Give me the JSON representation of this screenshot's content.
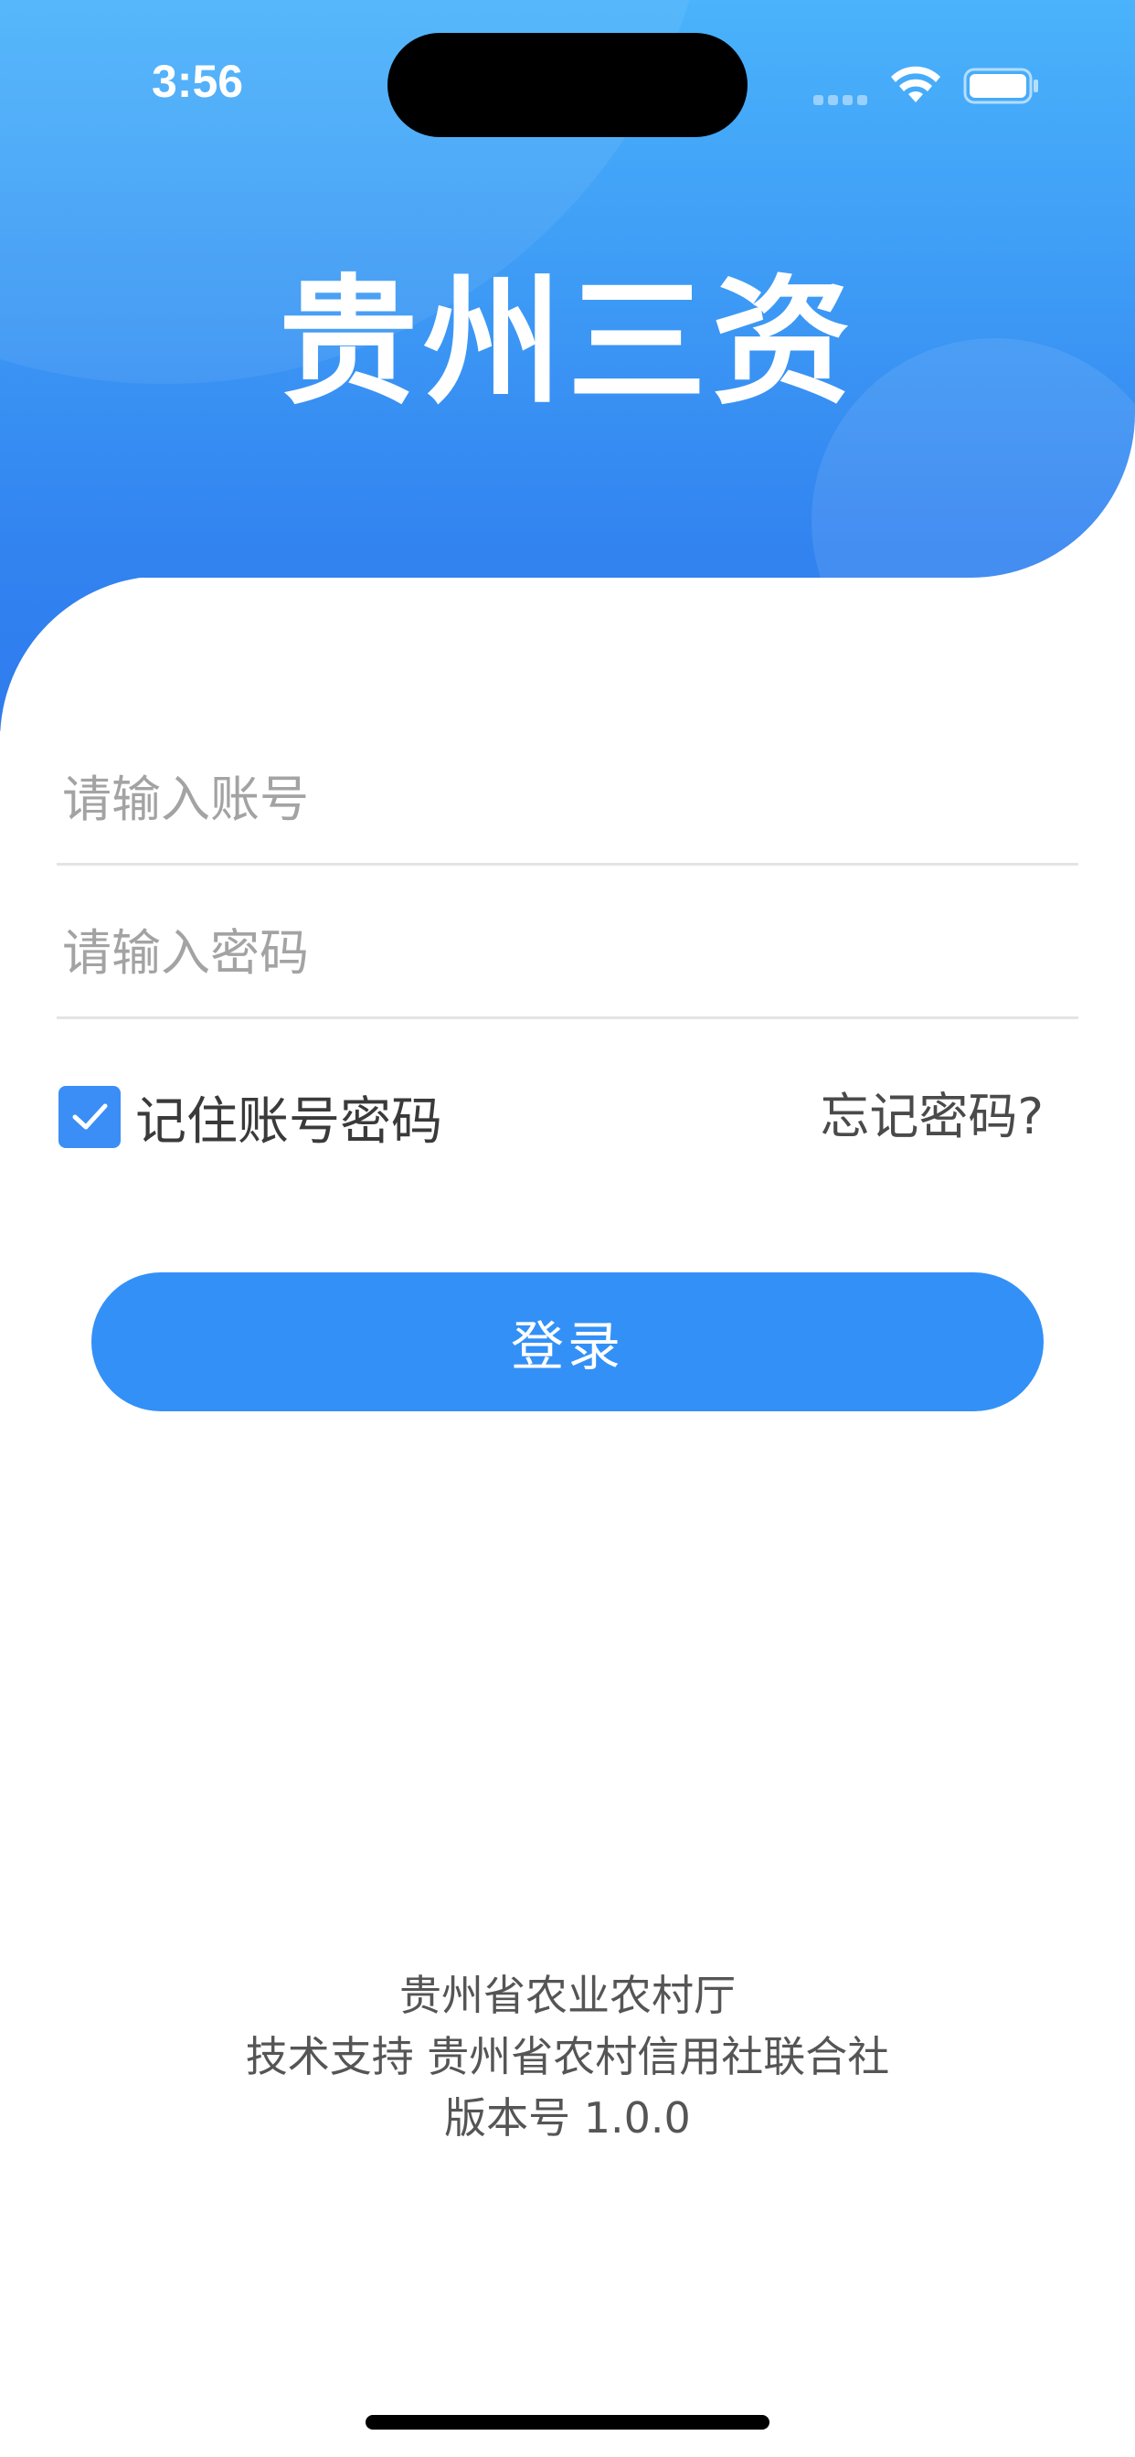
{
  "status_bar": {
    "time": "3:56"
  },
  "app": {
    "title": "贵州三资"
  },
  "form": {
    "account_placeholder": "请输入账号",
    "password_placeholder": "请输入密码",
    "remember_label": "记住账号密码",
    "remember_checked": true,
    "forgot_label": "忘记密码?",
    "login_label": "登录"
  },
  "footer": {
    "line1": "贵州省农业农村厅",
    "line2": "技术支持 贵州省农村信用社联合社",
    "line3": "版本号 1.0.0"
  },
  "colors": {
    "header_gradient_top": "#4ab3fb",
    "header_gradient_bottom": "#2f7bee",
    "accent": "#3390f7"
  },
  "icons": {
    "signal": "signal-dots-icon",
    "wifi": "wifi-icon",
    "battery": "battery-icon",
    "checkbox": "checkmark-icon"
  }
}
